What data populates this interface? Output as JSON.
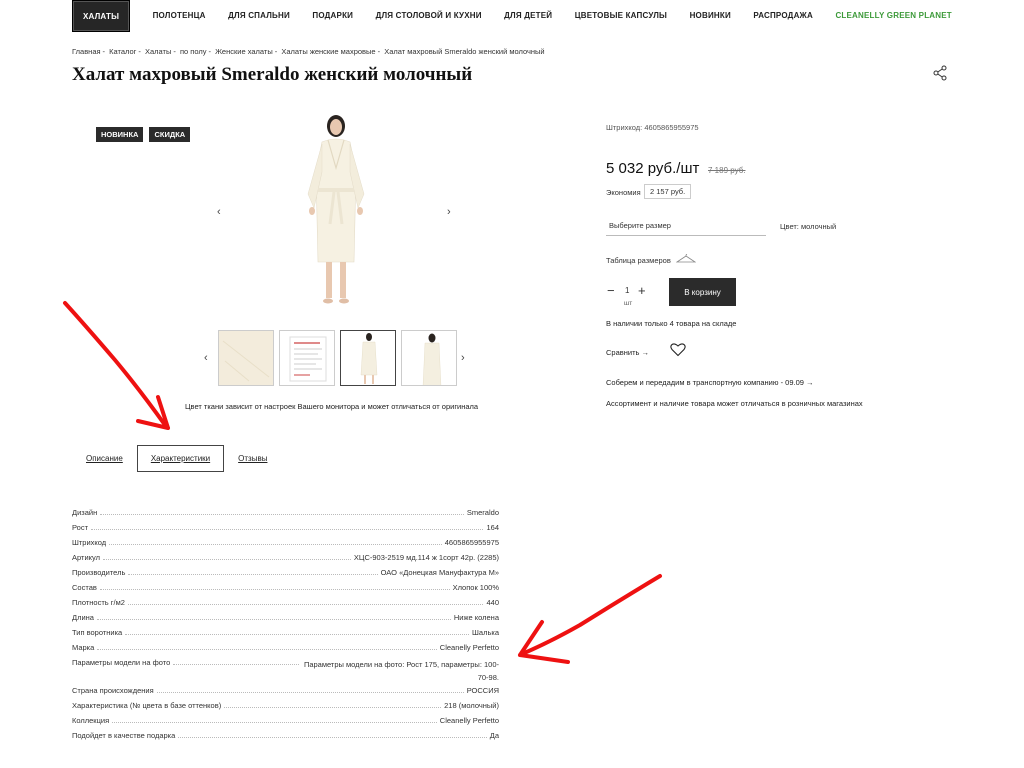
{
  "nav": {
    "items": [
      {
        "label": "ХАЛАТЫ"
      },
      {
        "label": "ПОЛОТЕНЦА"
      },
      {
        "label": "ДЛЯ СПАЛЬНИ"
      },
      {
        "label": "ПОДАРКИ"
      },
      {
        "label": "ДЛЯ СТОЛОВОЙ И КУХНИ"
      },
      {
        "label": "ДЛЯ ДЕТЕЙ"
      },
      {
        "label": "ЦВЕТОВЫЕ КАПСУЛЫ"
      },
      {
        "label": "НОВИНКИ"
      },
      {
        "label": "РАСПРОДАЖА"
      },
      {
        "label": "CLEANELLY GREEN PLANET"
      }
    ]
  },
  "breadcrumb": [
    "Главная",
    "Каталог",
    "Халаты",
    "по полу",
    "Женские халаты",
    "Халаты женские махровые",
    "Халат махровый Smeraldo женский молочный"
  ],
  "breadcrumb_sep": "-",
  "title": "Халат махровый Smeraldo женский молочный",
  "badges": [
    "НОВИНКА",
    "СКИДКА"
  ],
  "gallery": {
    "prev": "‹",
    "next": "›",
    "color_note": "Цвет ткани зависит от настроек Вашего монитора и может отличаться от оригинала"
  },
  "tabs": {
    "description": "Описание",
    "characteristics": "Характеристики",
    "reviews": "Отзывы"
  },
  "specs": [
    {
      "label": "Дизайн",
      "value": "Smeraldo"
    },
    {
      "label": "Рост",
      "value": "164"
    },
    {
      "label": "Штрихкод",
      "value": "4605865955975"
    },
    {
      "label": "Артикул",
      "value": "ХЦС-903-2519 мд.114 ж 1сорт 42р. (2285)"
    },
    {
      "label": "Производитель",
      "value": "ОАО «Донецкая Мануфактура М»"
    },
    {
      "label": "Состав",
      "value": "Хлопок 100%"
    },
    {
      "label": "Плотность г/м2",
      "value": "440"
    },
    {
      "label": "Длина",
      "value": "Ниже колена"
    },
    {
      "label": "Тип воротника",
      "value": "Шалька"
    },
    {
      "label": "Марка",
      "value": "Cleanelly Perfetto"
    },
    {
      "label": "Параметры модели на фото",
      "value": "Параметры модели на фото: Рост 175, параметры: 100-70-98."
    },
    {
      "label": "Страна происхождения",
      "value": "РОССИЯ"
    },
    {
      "label": "Характеристика (№ цвета в базе оттенков)",
      "value": "218 (молочный)"
    },
    {
      "label": "Коллекция",
      "value": "Cleanelly Perfetto"
    },
    {
      "label": "Подойдет в качестве подарка",
      "value": "Да"
    }
  ],
  "product": {
    "barcode": "Штрихкод: 4605865955975",
    "price": "5 032 руб./шт",
    "old_price": "7 189 руб.",
    "saving_label": "Экономия",
    "saving_value": "2 157 руб.",
    "size_placeholder": "Выберите размер",
    "color": "Цвет: молочный",
    "size_table": "Таблица размеров",
    "qty": "1",
    "qty_unit": "шт",
    "minus": "−",
    "plus": "+",
    "add_to_cart": "В корзину",
    "stock": "В наличии только 4 товара на складе",
    "compare": "Сравнить →",
    "delivery": "Соберем и передадим в транспортную компанию - 09.09 →",
    "assortment": "Ассортимент и наличие товара может отличаться в розничных магазинах"
  },
  "colors": {
    "accent_dark": "#2b2b2b",
    "green": "#3d9a3a",
    "annotation_red": "#e11"
  }
}
